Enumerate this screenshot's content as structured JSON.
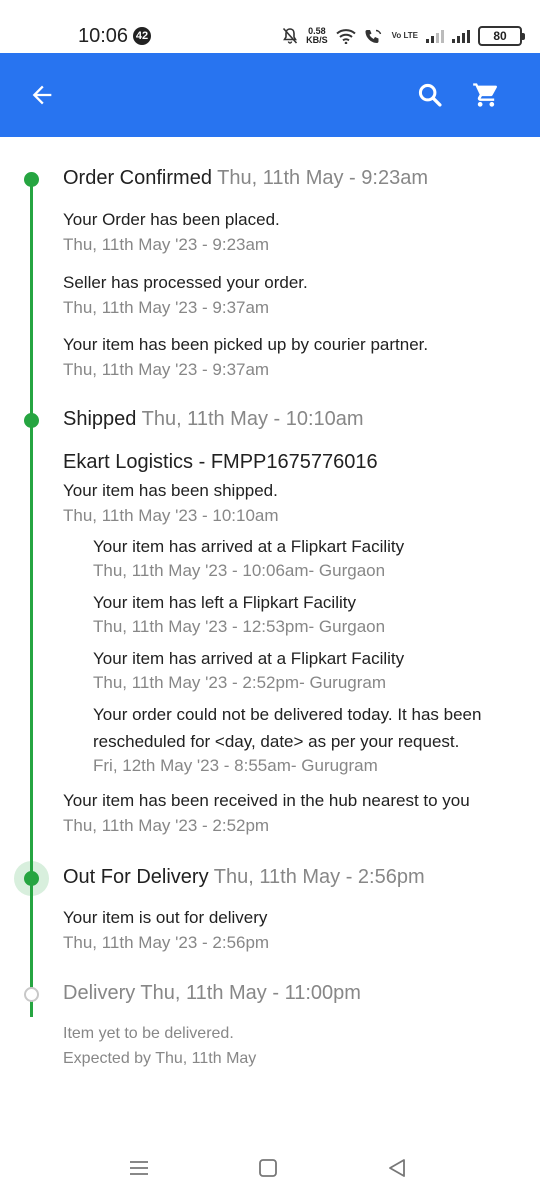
{
  "status_bar": {
    "time": "10:06",
    "notification_count": "42",
    "speed_value": "0.58",
    "speed_unit": "KB/S",
    "volte": "Vo LTE",
    "battery": "80"
  },
  "app_bar": {
    "background": "#2874f0",
    "icons": [
      "back-arrow-icon",
      "search-icon",
      "cart-icon"
    ]
  },
  "timeline": {
    "accent": "#26a541",
    "stages": {
      "confirmed": {
        "title": "Order Confirmed",
        "date": "Thu, 11th May - 9:23am",
        "events": [
          {
            "text": "Your Order has been placed.",
            "time": "Thu, 11th May '23 - 9:23am"
          },
          {
            "text": "Seller has processed your order.",
            "time": "Thu, 11th May '23 - 9:37am"
          },
          {
            "text": "Your item has been picked up by courier partner.",
            "time": "Thu, 11th May '23 - 9:37am"
          }
        ]
      },
      "shipped": {
        "title": "Shipped",
        "date": "Thu, 11th May - 10:10am",
        "courier": "Ekart Logistics - FMPP1675776016",
        "event": {
          "text": "Your item has been shipped.",
          "time": "Thu, 11th May '23 - 10:10am"
        },
        "sub_events": [
          {
            "text": "Your item has arrived at a Flipkart Facility",
            "time": "Thu, 11th May '23 - 10:06am- Gurgaon"
          },
          {
            "text": "Your item has left a Flipkart Facility",
            "time": "Thu, 11th May '23 - 12:53pm- Gurgaon"
          },
          {
            "text": "Your item has arrived at a Flipkart Facility",
            "time": "Thu, 11th May '23 - 2:52pm- Gurugram"
          },
          {
            "text_line1": "Your order could not be delivered today. It has been",
            "text_line2": "rescheduled for <day, date> as per your request.",
            "time": "Fri, 12th May '23 - 8:55am- Gurugram"
          }
        ],
        "hub_event": {
          "text": "Your item has been received in the hub nearest to you",
          "time": "Thu, 11th May '23 - 2:52pm"
        }
      },
      "out_for_delivery": {
        "title": "Out For Delivery",
        "date": "Thu, 11th May - 2:56pm",
        "event": {
          "text": "Your item is out for delivery",
          "time": "Thu, 11th May '23 - 2:56pm"
        }
      },
      "delivery": {
        "title": "Delivery Thu, 11th May - 11:00pm",
        "line1": "Item yet to be delivered.",
        "line2": "Expected by Thu, 11th May"
      }
    }
  },
  "nav_bar": {
    "icons": [
      "recents-icon",
      "home-icon",
      "back-icon"
    ]
  }
}
